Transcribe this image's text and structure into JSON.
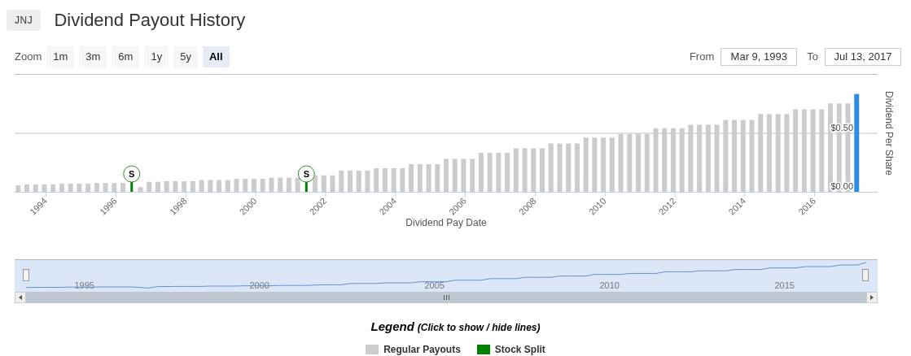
{
  "ticker": "JNJ",
  "title": "Dividend Payout History",
  "zoom": {
    "label": "Zoom",
    "buttons": [
      {
        "label": "1m",
        "selected": false
      },
      {
        "label": "3m",
        "selected": false
      },
      {
        "label": "6m",
        "selected": false
      },
      {
        "label": "1y",
        "selected": false
      },
      {
        "label": "5y",
        "selected": false
      },
      {
        "label": "All",
        "selected": true
      }
    ]
  },
  "range": {
    "from_label": "From",
    "from": "Mar 9, 1993",
    "to_label": "To",
    "to": "Jul 13, 2017"
  },
  "chart_data": {
    "type": "bar",
    "xlabel": "Dividend Pay Date",
    "ylabel": "Dividend Per Share",
    "x": [
      1993.2,
      1993.45,
      1993.7,
      1993.95,
      1994.2,
      1994.45,
      1994.7,
      1994.95,
      1995.2,
      1995.45,
      1995.7,
      1995.95,
      1996.2,
      1996.45,
      1996.7,
      1996.95,
      1997.2,
      1997.45,
      1997.7,
      1997.95,
      1998.2,
      1998.45,
      1998.7,
      1998.95,
      1999.2,
      1999.45,
      1999.7,
      1999.95,
      2000.2,
      2000.45,
      2000.7,
      2000.95,
      2001.2,
      2001.45,
      2001.7,
      2001.95,
      2002.2,
      2002.45,
      2002.7,
      2002.95,
      2003.2,
      2003.45,
      2003.7,
      2003.95,
      2004.2,
      2004.45,
      2004.7,
      2004.95,
      2005.2,
      2005.45,
      2005.7,
      2005.95,
      2006.2,
      2006.45,
      2006.7,
      2006.95,
      2007.2,
      2007.45,
      2007.7,
      2007.95,
      2008.2,
      2008.45,
      2008.7,
      2008.95,
      2009.2,
      2009.45,
      2009.7,
      2009.95,
      2010.2,
      2010.45,
      2010.7,
      2010.95,
      2011.2,
      2011.45,
      2011.7,
      2011.95,
      2012.2,
      2012.45,
      2012.7,
      2012.95,
      2013.2,
      2013.45,
      2013.7,
      2013.95,
      2014.2,
      2014.45,
      2014.7,
      2014.95,
      2015.2,
      2015.45,
      2015.7,
      2015.95,
      2016.2,
      2016.45,
      2016.7,
      2016.95,
      2017.2
    ],
    "series": [
      {
        "name": "Regular Payouts",
        "color": "#cccccc",
        "values": [
          0.055,
          0.063,
          0.063,
          0.063,
          0.063,
          0.07,
          0.07,
          0.07,
          0.07,
          0.075,
          0.075,
          0.075,
          0.075,
          null,
          0.04,
          0.085,
          0.085,
          0.09,
          0.09,
          0.09,
          0.09,
          0.1,
          0.1,
          0.1,
          0.1,
          0.11,
          0.11,
          0.11,
          0.11,
          0.12,
          0.12,
          0.12,
          0.12,
          null,
          0.14,
          0.14,
          0.14,
          0.18,
          0.18,
          0.18,
          0.18,
          0.2,
          0.2,
          0.2,
          0.2,
          0.235,
          0.235,
          0.235,
          0.235,
          0.28,
          0.28,
          0.28,
          0.28,
          0.33,
          0.33,
          0.33,
          0.33,
          0.37,
          0.37,
          0.37,
          0.37,
          0.41,
          0.41,
          0.41,
          0.41,
          0.46,
          0.46,
          0.46,
          0.46,
          0.49,
          0.49,
          0.49,
          0.49,
          0.54,
          0.54,
          0.54,
          0.54,
          0.57,
          0.57,
          0.57,
          0.57,
          0.61,
          0.61,
          0.61,
          0.61,
          0.66,
          0.66,
          0.66,
          0.66,
          0.7,
          0.7,
          0.7,
          0.7,
          0.75,
          0.75,
          0.75,
          null
        ]
      },
      {
        "color": "#2b8de8",
        "values": [
          null,
          null,
          null,
          null,
          null,
          null,
          null,
          null,
          null,
          null,
          null,
          null,
          null,
          null,
          null,
          null,
          null,
          null,
          null,
          null,
          null,
          null,
          null,
          null,
          null,
          null,
          null,
          null,
          null,
          null,
          null,
          null,
          null,
          null,
          null,
          null,
          null,
          null,
          null,
          null,
          null,
          null,
          null,
          null,
          null,
          null,
          null,
          null,
          null,
          null,
          null,
          null,
          null,
          null,
          null,
          null,
          null,
          null,
          null,
          null,
          null,
          null,
          null,
          null,
          null,
          null,
          null,
          null,
          null,
          null,
          null,
          null,
          null,
          null,
          null,
          null,
          null,
          null,
          null,
          null,
          null,
          null,
          null,
          null,
          null,
          null,
          null,
          null,
          null,
          null,
          null,
          null,
          null,
          null,
          null,
          null,
          0.83
        ]
      }
    ],
    "xlim": [
      1993.1,
      2017.8
    ],
    "ylim": [
      0,
      1
    ],
    "xticks": [
      {
        "value": 1994,
        "label": "1994"
      },
      {
        "value": 1996,
        "label": "1996"
      },
      {
        "value": 1998,
        "label": "1998"
      },
      {
        "value": 2000,
        "label": "2000"
      },
      {
        "value": 2002,
        "label": "2002"
      },
      {
        "value": 2004,
        "label": "2004"
      },
      {
        "value": 2006,
        "label": "2006"
      },
      {
        "value": 2008,
        "label": "2008"
      },
      {
        "value": 2010,
        "label": "2010"
      },
      {
        "value": 2012,
        "label": "2012"
      },
      {
        "value": 2014,
        "label": "2014"
      },
      {
        "value": 2016,
        "label": "2016"
      }
    ],
    "yticks": [
      {
        "value": 0,
        "label": "$0.00"
      },
      {
        "value": 0.5,
        "label": "$0.50"
      }
    ],
    "annotations": [
      {
        "x": 1996.45,
        "text": "S"
      },
      {
        "x": 2001.45,
        "text": "S"
      }
    ]
  },
  "navigator": {
    "labels": [
      "1995",
      "2000",
      "2005",
      "2010",
      "2015"
    ]
  },
  "legend": {
    "title": "Legend",
    "hint": "(Click to show / hide lines)",
    "items": [
      {
        "label": "Stock Split",
        "color": "#008000"
      }
    ]
  }
}
